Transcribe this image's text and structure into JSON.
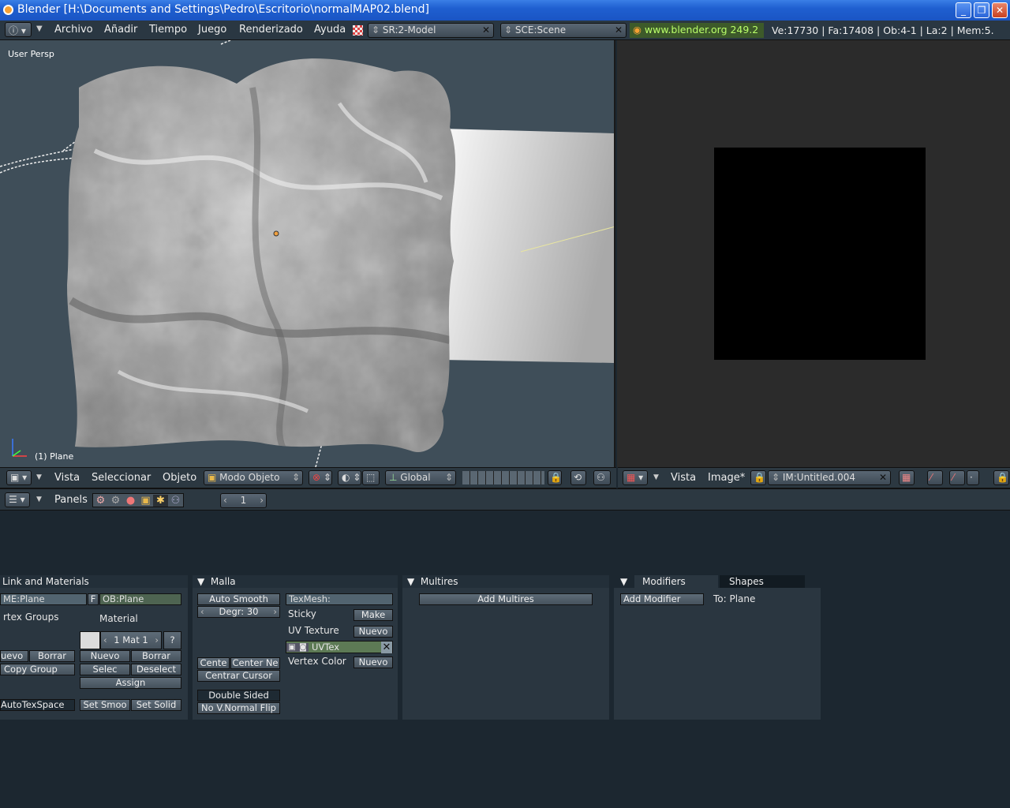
{
  "window": {
    "title": "Blender [H:\\Documents and Settings\\Pedro\\Escritorio\\normalMAP02.blend]"
  },
  "menubar": {
    "items": [
      "Archivo",
      "Añadir",
      "Tiempo",
      "Juego",
      "Renderizado",
      "Ayuda"
    ],
    "screen": "SR:2-Model",
    "scene": "SCE:Scene",
    "version": "www.blender.org 249.2",
    "stats": "Ve:17730 | Fa:17408 | Ob:4-1 | La:2  | Mem:5."
  },
  "view3d": {
    "view_name": "User Persp",
    "object_label": "(1) Plane",
    "header": {
      "items": [
        "Vista",
        "Seleccionar",
        "Objeto"
      ],
      "mode": "Modo Objeto",
      "orientation": "Global"
    }
  },
  "uvview": {
    "header": {
      "items": [
        "Vista",
        "Image*"
      ],
      "image": "IM:Untitled.004"
    }
  },
  "buttons": {
    "header": {
      "label": "Panels",
      "frame": "1"
    },
    "link_materials": {
      "title": "Link and Materials",
      "me_field": "ME:Plane",
      "f_btn": "F",
      "ob_field": "OB:Plane",
      "vertex_groups": "rtex Groups",
      "material_label": "Material",
      "mat_slot": "1 Mat 1",
      "help": "?",
      "vg_new": "uevo",
      "vg_delete": "Borrar",
      "copy_group": "Copy Group",
      "mat_new": "Nuevo",
      "mat_delete": "Borrar",
      "select": "Selec",
      "deselect": "Deselect",
      "assign": "Assign",
      "autotex": "AutoTexSpace",
      "set_smooth": "Set Smoo",
      "set_solid": "Set Solid"
    },
    "mesh": {
      "title": "Malla",
      "auto_smooth": "Auto Smooth",
      "degr": "Degr: 30",
      "texmesh": "TexMesh:",
      "sticky": "Sticky",
      "make": "Make",
      "uv_texture": "UV Texture",
      "uv_new": "Nuevo",
      "uvtex": "UVTex",
      "vertex_color": "Vertex Color",
      "vc_new": "Nuevo",
      "centre": "Cente",
      "centre_new": "Center Ne",
      "centre_cursor": "Centrar Cursor",
      "double_sided": "Double Sided",
      "no_vnormal_flip": "No V.Normal Flip"
    },
    "multires": {
      "title": "Multires",
      "add": "Add Multires"
    },
    "modifiers": {
      "tab1": "Modifiers",
      "tab2": "Shapes",
      "add": "Add Modifier",
      "to": "To: Plane"
    }
  }
}
